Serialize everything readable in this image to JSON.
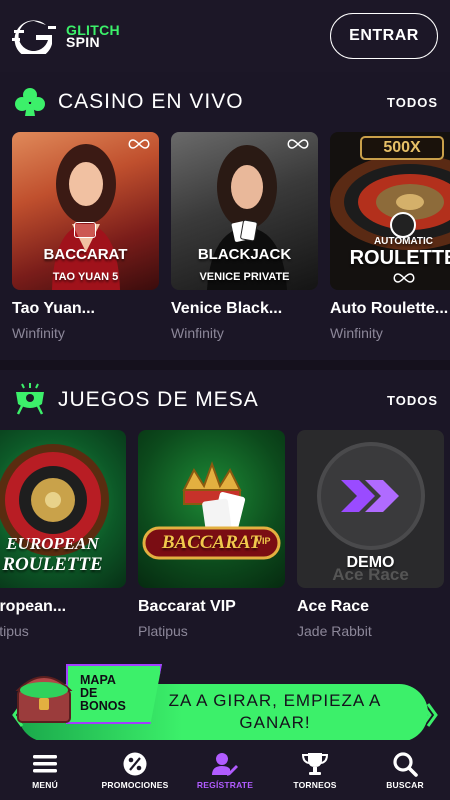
{
  "header": {
    "logo_line1": "GLITCH",
    "logo_line2": "SPIN",
    "login_label": "ENTRAR"
  },
  "sections": [
    {
      "title": "CASINO EN VIVO",
      "all_label": "TODOS",
      "icon": "club-icon",
      "games": [
        {
          "name": "Tao Yuan...",
          "provider": "Winfinity",
          "thumb_title": "BACCARAT",
          "thumb_sub": "TAO YUAN 5"
        },
        {
          "name": "Venice Black...",
          "provider": "Winfinity",
          "thumb_title": "BLACKJACK",
          "thumb_sub": "VENICE PRIVATE"
        },
        {
          "name": "Auto Roulette...",
          "provider": "Winfinity",
          "thumb_title": "ROULETTE",
          "thumb_top": "AUTOMATIC",
          "badge": "500X"
        }
      ]
    },
    {
      "title": "JUEGOS DE MESA",
      "all_label": "TODOS",
      "icon": "table-games-icon",
      "games": [
        {
          "name": "European...",
          "provider": "Platipus",
          "thumb_title": "EUROPEAN",
          "thumb_sub": "ROULETTE"
        },
        {
          "name": "Baccarat VIP",
          "provider": "Platipus",
          "thumb_title": "BACCARAT",
          "thumb_sub": "VIP"
        },
        {
          "name": "Ace Race",
          "provider": "Jade Rabbit",
          "thumb_title": "DEMO",
          "thumb_sub": "Ace Race"
        }
      ]
    }
  ],
  "promo": {
    "tag_line1": "MAPA",
    "tag_line2": "DE",
    "tag_line3": "BONOS",
    "banner_line1": "ZA A GIRAR, EMPIEZA A",
    "banner_line2": "GANAR!"
  },
  "bottom_nav": [
    {
      "label": "MENÚ",
      "icon": "menu-icon",
      "active": false
    },
    {
      "label": "PROMOCIONES",
      "icon": "percent-icon",
      "active": false
    },
    {
      "label": "REGÍSTRATE",
      "icon": "register-icon",
      "active": true
    },
    {
      "label": "TORNEOS",
      "icon": "trophy-icon",
      "active": false
    },
    {
      "label": "BUSCAR",
      "icon": "search-icon",
      "active": false
    }
  ],
  "colors": {
    "background": "#1b1626",
    "accent_green": "#3cf06a",
    "accent_purple": "#b15cff",
    "muted_text": "#8c8799"
  }
}
